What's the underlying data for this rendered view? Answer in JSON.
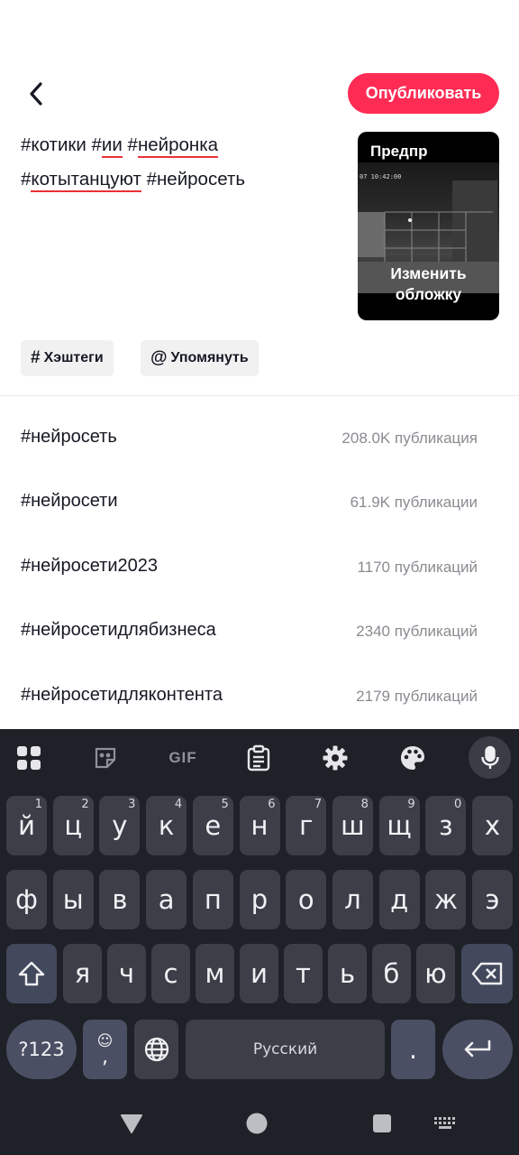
{
  "header": {
    "publish_label": "Опубликовать"
  },
  "caption": {
    "hashtags": [
      "#котики",
      "#ии",
      "#нейронка",
      "#котытанцуют",
      "#нейросеть"
    ]
  },
  "cover": {
    "preview_label": "Предпр",
    "timestamp": "07 10:42:00",
    "change_label": "Изменить обложку"
  },
  "chips": {
    "hashtags_label": "Хэштеги",
    "mention_label": "Упомянуть"
  },
  "suggestions": [
    {
      "name": "#нейросеть",
      "count": "208.0K публикация"
    },
    {
      "name": "#нейросети",
      "count": "61.9K публикации"
    },
    {
      "name": "#нейросети2023",
      "count": "1170 публикаций"
    },
    {
      "name": "#нейросетидлябизнеса",
      "count": "2340 публикаций"
    },
    {
      "name": "#нейросетидляконтента",
      "count": "2179 публикаций"
    }
  ],
  "keyboard": {
    "toolbar": {
      "gif_label": "GIF"
    },
    "row1": [
      {
        "key": "й",
        "hint": "1"
      },
      {
        "key": "ц",
        "hint": "2"
      },
      {
        "key": "у",
        "hint": "3"
      },
      {
        "key": "к",
        "hint": "4"
      },
      {
        "key": "е",
        "hint": "5"
      },
      {
        "key": "н",
        "hint": "6"
      },
      {
        "key": "г",
        "hint": "7"
      },
      {
        "key": "ш",
        "hint": "8"
      },
      {
        "key": "щ",
        "hint": "9"
      },
      {
        "key": "з",
        "hint": "0"
      },
      {
        "key": "х",
        "hint": ""
      }
    ],
    "row2": [
      "ф",
      "ы",
      "в",
      "а",
      "п",
      "р",
      "о",
      "л",
      "д",
      "ж",
      "э"
    ],
    "row3": [
      "я",
      "ч",
      "с",
      "м",
      "и",
      "т",
      "ь",
      "б",
      "ю"
    ],
    "row4": {
      "symbols_label": "?123",
      "comma_label": ",",
      "space_label": "Русский",
      "period_label": "."
    }
  },
  "colors": {
    "accent": "#fe2c55",
    "keyboard_bg": "#1f2128",
    "key_bg": "#3c3f48"
  }
}
